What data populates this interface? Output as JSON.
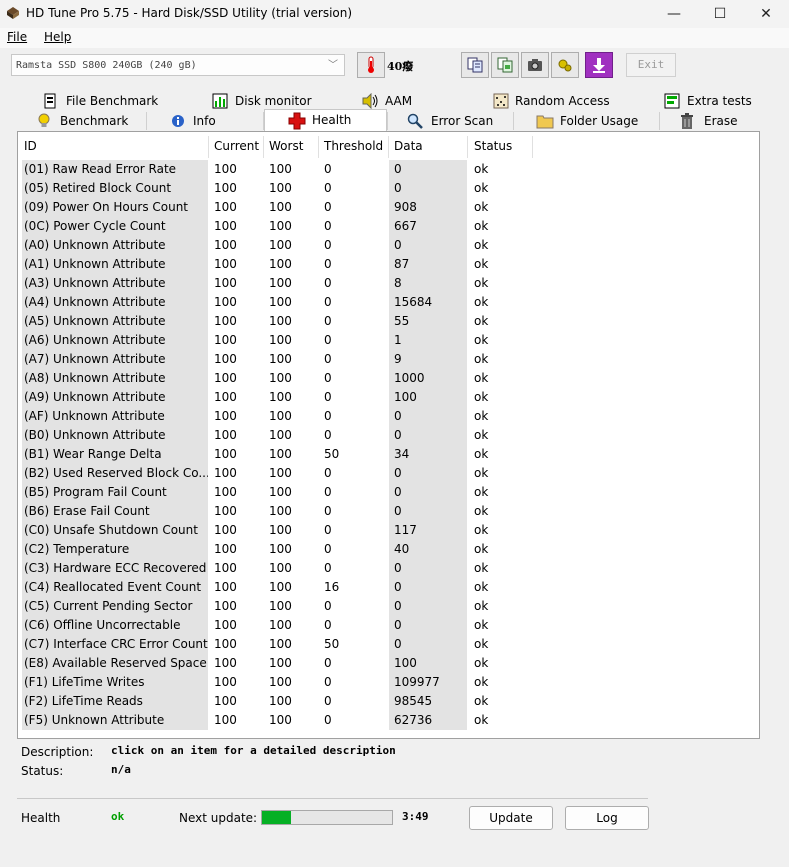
{
  "window": {
    "title": "HD Tune Pro 5.75 - Hard Disk/SSD Utility (trial version)",
    "minimize": "—",
    "maximize": "☐",
    "close": "✕"
  },
  "menu": {
    "file": "File",
    "help": "Help"
  },
  "toolbar": {
    "drive": "Ramsta SSD S800 240GB (240 gB)",
    "temperature": "40癈",
    "exit": "Exit"
  },
  "tabs": {
    "row1": [
      "File Benchmark",
      "Disk monitor",
      "AAM",
      "Random Access",
      "Extra tests"
    ],
    "row2": [
      "Benchmark",
      "Info",
      "Health",
      "Error Scan",
      "Folder Usage",
      "Erase"
    ],
    "active": "Health"
  },
  "table": {
    "headers": [
      "ID",
      "Current",
      "Worst",
      "Threshold",
      "Data",
      "Status"
    ],
    "rows": [
      [
        "(01) Raw Read Error Rate",
        "100",
        "100",
        "0",
        "0",
        "ok"
      ],
      [
        "(05) Retired Block Count",
        "100",
        "100",
        "0",
        "0",
        "ok"
      ],
      [
        "(09) Power On Hours Count",
        "100",
        "100",
        "0",
        "908",
        "ok"
      ],
      [
        "(0C) Power Cycle Count",
        "100",
        "100",
        "0",
        "667",
        "ok"
      ],
      [
        "(A0) Unknown Attribute",
        "100",
        "100",
        "0",
        "0",
        "ok"
      ],
      [
        "(A1) Unknown Attribute",
        "100",
        "100",
        "0",
        "87",
        "ok"
      ],
      [
        "(A3) Unknown Attribute",
        "100",
        "100",
        "0",
        "8",
        "ok"
      ],
      [
        "(A4) Unknown Attribute",
        "100",
        "100",
        "0",
        "15684",
        "ok"
      ],
      [
        "(A5) Unknown Attribute",
        "100",
        "100",
        "0",
        "55",
        "ok"
      ],
      [
        "(A6) Unknown Attribute",
        "100",
        "100",
        "0",
        "1",
        "ok"
      ],
      [
        "(A7) Unknown Attribute",
        "100",
        "100",
        "0",
        "9",
        "ok"
      ],
      [
        "(A8) Unknown Attribute",
        "100",
        "100",
        "0",
        "1000",
        "ok"
      ],
      [
        "(A9) Unknown Attribute",
        "100",
        "100",
        "0",
        "100",
        "ok"
      ],
      [
        "(AF) Unknown Attribute",
        "100",
        "100",
        "0",
        "0",
        "ok"
      ],
      [
        "(B0) Unknown Attribute",
        "100",
        "100",
        "0",
        "0",
        "ok"
      ],
      [
        "(B1) Wear Range Delta",
        "100",
        "100",
        "50",
        "34",
        "ok"
      ],
      [
        "(B2) Used Reserved Block Co...",
        "100",
        "100",
        "0",
        "0",
        "ok"
      ],
      [
        "(B5) Program Fail Count",
        "100",
        "100",
        "0",
        "0",
        "ok"
      ],
      [
        "(B6) Erase Fail Count",
        "100",
        "100",
        "0",
        "0",
        "ok"
      ],
      [
        "(C0) Unsafe Shutdown Count",
        "100",
        "100",
        "0",
        "117",
        "ok"
      ],
      [
        "(C2) Temperature",
        "100",
        "100",
        "0",
        "40",
        "ok"
      ],
      [
        "(C3) Hardware ECC Recovered",
        "100",
        "100",
        "0",
        "0",
        "ok"
      ],
      [
        "(C4) Reallocated Event Count",
        "100",
        "100",
        "16",
        "0",
        "ok"
      ],
      [
        "(C5) Current Pending Sector",
        "100",
        "100",
        "0",
        "0",
        "ok"
      ],
      [
        "(C6) Offline Uncorrectable",
        "100",
        "100",
        "0",
        "0",
        "ok"
      ],
      [
        "(C7) Interface CRC Error Count",
        "100",
        "100",
        "50",
        "0",
        "ok"
      ],
      [
        "(E8) Available Reserved Space",
        "100",
        "100",
        "0",
        "100",
        "ok"
      ],
      [
        "(F1) LifeTime Writes",
        "100",
        "100",
        "0",
        "109977",
        "ok"
      ],
      [
        "(F2) LifeTime Reads",
        "100",
        "100",
        "0",
        "98545",
        "ok"
      ],
      [
        "(F5) Unknown Attribute",
        "100",
        "100",
        "0",
        "62736",
        "ok"
      ]
    ]
  },
  "details": {
    "description_label": "Description:",
    "description_value": "click on an item for a detailed description",
    "status_label": "Status:",
    "status_value": "n/a"
  },
  "footer": {
    "health_label": "Health",
    "health_value": "ok",
    "next_update_label": "Next update:",
    "progress_fraction": 0.22,
    "countdown": "3:49",
    "update_button": "Update",
    "log_button": "Log"
  },
  "colors": {
    "progress": "#06b025",
    "health_ok": "#00a000",
    "id_column_bg": "#e3e3e3"
  },
  "icons": {
    "app": "hdtune-app-icon",
    "toolbar": [
      "thermometer-icon",
      "copy-info-icon",
      "copy-screenshot-icon",
      "camera-icon",
      "settings-icon",
      "download-arrow-icon"
    ]
  }
}
